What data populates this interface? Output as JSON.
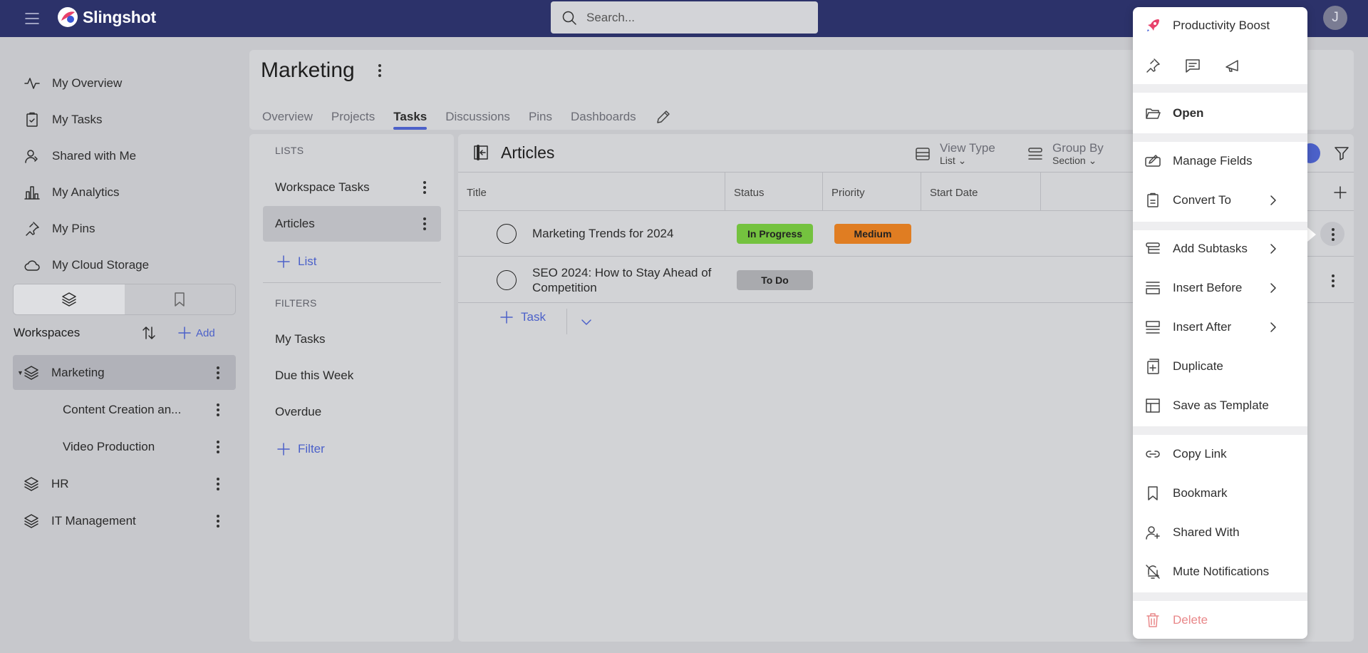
{
  "app": {
    "name": "Slingshot",
    "search_placeholder": "Search...",
    "avatar_initial": "J"
  },
  "sidebar": {
    "nav": [
      {
        "label": "My Overview",
        "icon": "activity-icon"
      },
      {
        "label": "My Tasks",
        "icon": "task-check-icon"
      },
      {
        "label": "Shared with Me",
        "icon": "shared-user-icon"
      },
      {
        "label": "My Analytics",
        "icon": "bar-chart-icon"
      },
      {
        "label": "My Pins",
        "icon": "pin-icon"
      },
      {
        "label": "My Cloud Storage",
        "icon": "cloud-icon"
      }
    ],
    "workspaces_title": "Workspaces",
    "add_label": "Add",
    "workspaces": [
      {
        "label": "Marketing",
        "active": true
      },
      {
        "label": "Content Creation an...",
        "sub": true
      },
      {
        "label": "Video Production",
        "sub": true
      },
      {
        "label": "HR"
      },
      {
        "label": "IT Management"
      }
    ]
  },
  "header": {
    "title": "Marketing",
    "tabs": [
      "Overview",
      "Projects",
      "Tasks",
      "Discussions",
      "Pins",
      "Dashboards"
    ],
    "active_tab": "Tasks"
  },
  "lists_panel": {
    "lists_label": "LISTS",
    "lists": [
      "Workspace Tasks",
      "Articles"
    ],
    "active_list": "Articles",
    "add_list_label": "List",
    "filters_label": "FILTERS",
    "filters": [
      "My Tasks",
      "Due this Week",
      "Overdue"
    ],
    "add_filter_label": "Filter"
  },
  "tasks_panel": {
    "title": "Articles",
    "view_type_label": "View Type",
    "view_type_value": "List",
    "group_by_label": "Group By",
    "group_by_value": "Section",
    "columns": [
      "Title",
      "Status",
      "Priority",
      "Start Date"
    ],
    "rows": [
      {
        "title": "Marketing Trends for 2024",
        "status": "In Progress",
        "priority": "Medium"
      },
      {
        "title": "SEO 2024: How to Stay Ahead of Competition",
        "status": "To Do",
        "priority": ""
      }
    ],
    "add_task_label": "Task"
  },
  "context_menu": {
    "boost_label": "Productivity Boost",
    "items": [
      {
        "label": "Open",
        "icon": "folder-open-icon",
        "bold": true
      },
      {
        "label": "Manage Fields",
        "icon": "edit-fields-icon"
      },
      {
        "label": "Convert To",
        "icon": "convert-icon",
        "submenu": true
      },
      {
        "label": "Add Subtasks",
        "icon": "subtasks-icon",
        "submenu": true
      },
      {
        "label": "Insert Before",
        "icon": "insert-before-icon",
        "submenu": true
      },
      {
        "label": "Insert After",
        "icon": "insert-after-icon",
        "submenu": true
      },
      {
        "label": "Duplicate",
        "icon": "duplicate-icon"
      },
      {
        "label": "Save as Template",
        "icon": "template-icon"
      },
      {
        "label": "Copy Link",
        "icon": "link-icon"
      },
      {
        "label": "Bookmark",
        "icon": "bookmark-icon"
      },
      {
        "label": "Shared With",
        "icon": "shared-with-icon"
      },
      {
        "label": "Mute Notifications",
        "icon": "bell-off-icon"
      },
      {
        "label": "Delete",
        "icon": "trash-icon",
        "danger": true
      }
    ]
  },
  "colors": {
    "topbar": "#2c326a",
    "accent": "#4c61c9",
    "status_in_progress": "#74c23f",
    "status_todo": "#a9aaae",
    "priority_medium": "#e07d22",
    "danger": "#e9888a"
  }
}
